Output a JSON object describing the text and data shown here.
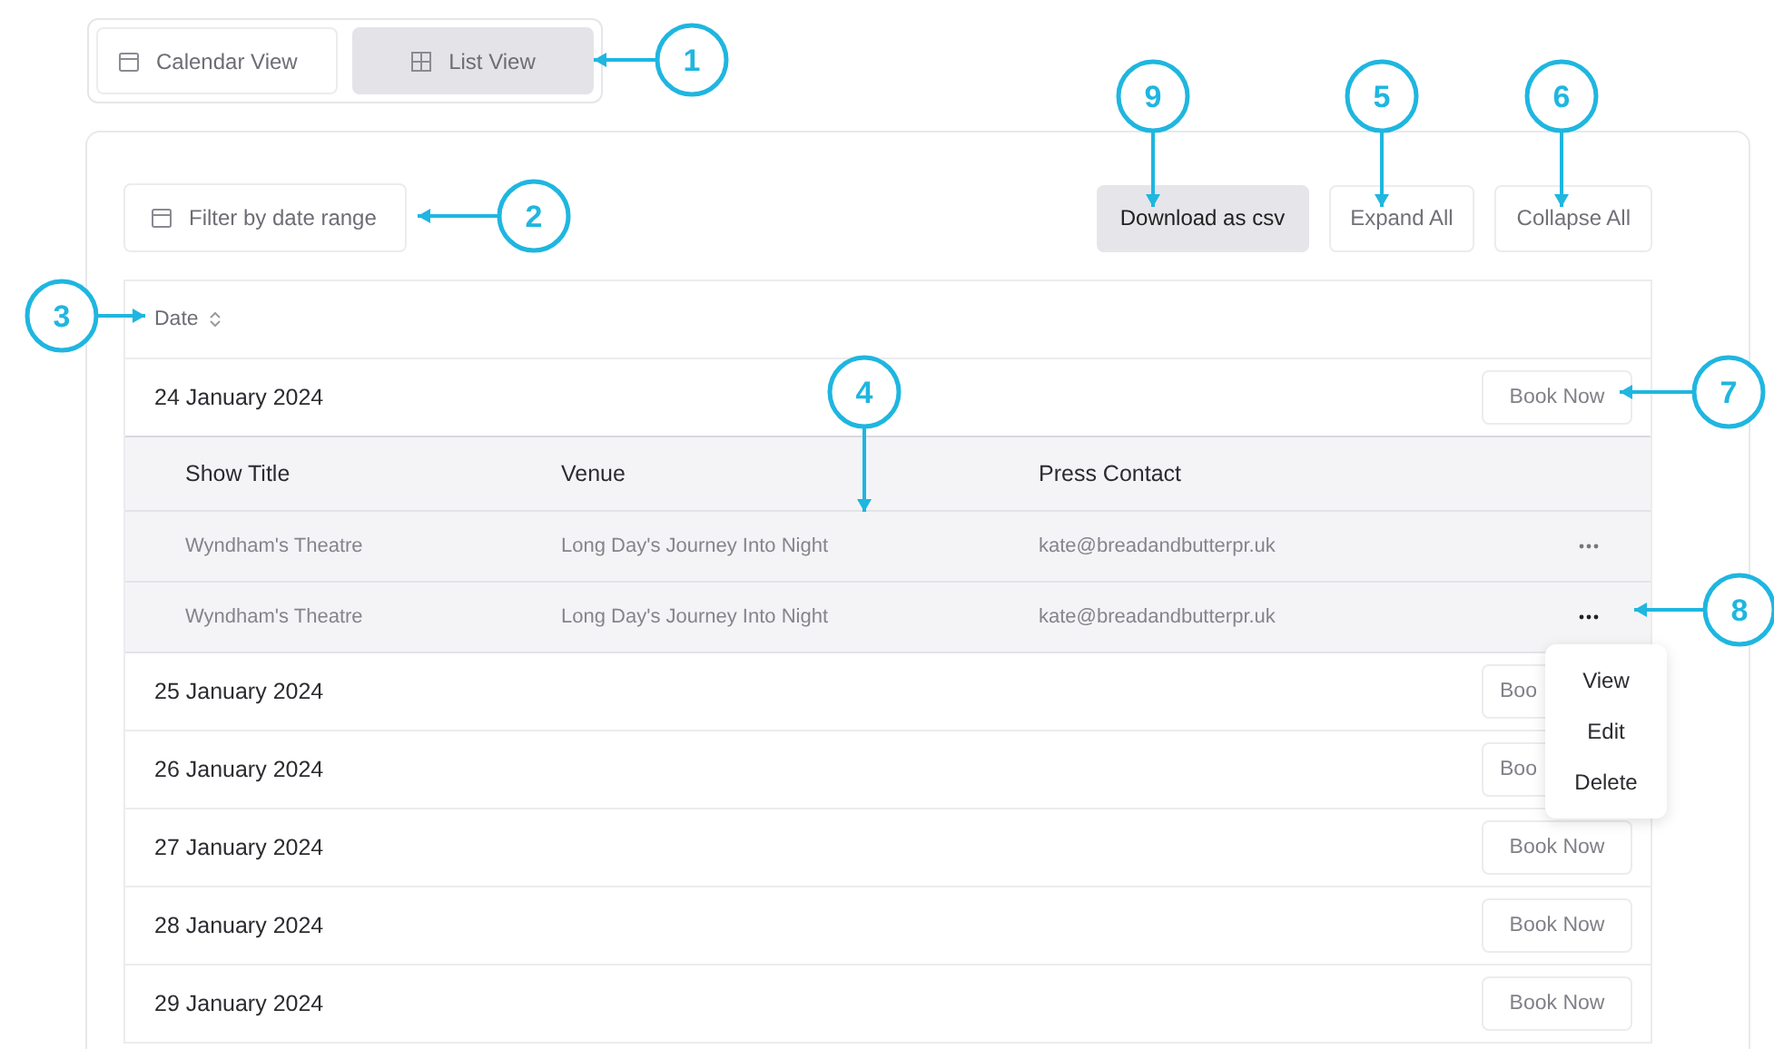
{
  "view_switch": [
    {
      "label": "Calendar View",
      "selected": false
    },
    {
      "label": "List View",
      "selected": true
    }
  ],
  "filter": {
    "label": "Filter by date range"
  },
  "actions": [
    {
      "label": "Download as csv",
      "kind": "primary"
    },
    {
      "label": "Expand All",
      "kind": "outline"
    },
    {
      "label": "Collapse All",
      "kind": "outline"
    }
  ],
  "table": {
    "sort_column": "Date",
    "groups": [
      {
        "date": "24 January 2024",
        "button": "Book Now",
        "expanded": true,
        "columns": [
          "Show Title",
          "Venue",
          "Press Contact"
        ],
        "rows": [
          {
            "cells": [
              "Wyndham's Theatre",
              "Long Day's Journey Into Night",
              "kate@breadandbutterpr.uk"
            ],
            "menu_open": false
          },
          {
            "cells": [
              "Wyndham's Theatre",
              "Long Day's Journey Into Night",
              "kate@breadandbutterpr.uk"
            ],
            "menu_open": true
          }
        ]
      },
      {
        "date": "25 January 2024",
        "button": "Boo",
        "expanded": false
      },
      {
        "date": "26 January 2024",
        "button": "Boo",
        "expanded": false
      },
      {
        "date": "27 January 2024",
        "button": "Book Now",
        "expanded": false
      },
      {
        "date": "28 January 2024",
        "button": "Book Now",
        "expanded": false
      },
      {
        "date": "29 January 2024",
        "button": "Book Now",
        "expanded": false
      }
    ]
  },
  "row_menu": {
    "items": [
      "View",
      "Edit",
      "Delete"
    ]
  },
  "callouts": [
    {
      "label": "1"
    },
    {
      "label": "2"
    },
    {
      "label": "3"
    },
    {
      "label": "4"
    },
    {
      "label": "5"
    },
    {
      "label": "6"
    },
    {
      "label": "7"
    },
    {
      "label": "8"
    },
    {
      "label": "9"
    }
  ]
}
